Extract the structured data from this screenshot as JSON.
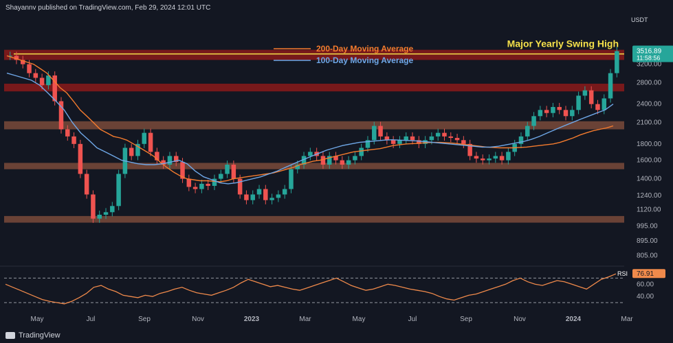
{
  "header": {
    "publisher": "Shayannv published on TradingView.com, Feb 29, 2024 12:01 UTC"
  },
  "footer": {
    "brand": "TradingView"
  },
  "colors": {
    "bg": "#131722",
    "up": "#26a69a",
    "down": "#ef5350",
    "ma200": "#f57c2e",
    "ma100": "#6fa8e8",
    "zone_red": "#8b1a1a",
    "zone_brown": "#7a4a3a",
    "rsi": "#f08a4b",
    "swing": "#f5e04a"
  },
  "chart_data": {
    "type": "candlestick",
    "currency": "USDT",
    "price_scale": "log",
    "ylim": [
      760,
      4050
    ],
    "price_ticks": [
      "3200.00",
      "2800.00",
      "2400.00",
      "2100.00",
      "1800.00",
      "1600.00",
      "1400.00",
      "1240.00",
      "1120.00",
      "995.00",
      "895.00",
      "805.00"
    ],
    "last_price": "3516.89",
    "countdown": "11:58:56",
    "time_labels": [
      "May",
      "Jul",
      "Sep",
      "Nov",
      "2023",
      "Mar",
      "May",
      "Jul",
      "Sep",
      "Nov",
      "2024",
      "Mar"
    ],
    "annotation": "Major Yearly Swing High",
    "legend": [
      "200-Day Moving Average",
      "100-Day Moving Average"
    ],
    "zones": [
      {
        "color": "red",
        "low": 3300,
        "high": 3550
      },
      {
        "color": "red",
        "low": 2630,
        "high": 2780
      },
      {
        "color": "brown",
        "low": 2000,
        "high": 2120
      },
      {
        "color": "brown",
        "low": 1500,
        "high": 1570
      },
      {
        "color": "brown",
        "low": 1020,
        "high": 1070
      }
    ],
    "closes": [
      3400,
      3300,
      3200,
      3000,
      2900,
      2750,
      2950,
      2450,
      2000,
      1900,
      1800,
      1450,
      1250,
      1050,
      1080,
      1100,
      1150,
      1450,
      1750,
      1650,
      1800,
      1950,
      1700,
      1600,
      1550,
      1650,
      1580,
      1400,
      1320,
      1300,
      1350,
      1330,
      1400,
      1450,
      1550,
      1400,
      1250,
      1200,
      1250,
      1300,
      1200,
      1220,
      1250,
      1300,
      1500,
      1550,
      1650,
      1700,
      1650,
      1550,
      1650,
      1600,
      1550,
      1600,
      1650,
      1750,
      1850,
      2050,
      1900,
      1850,
      1800,
      1850,
      1900,
      1850,
      1800,
      1850,
      1900,
      1950,
      1900,
      1880,
      1850,
      1800,
      1650,
      1620,
      1600,
      1620,
      1650,
      1600,
      1700,
      1800,
      1900,
      2050,
      2200,
      2300,
      2250,
      2350,
      2300,
      2200,
      2300,
      2550,
      2650,
      2400,
      2300,
      2500,
      3000,
      3516.89
    ],
    "ma200": [
      3400,
      3350,
      3300,
      3250,
      3200,
      3100,
      3000,
      2850,
      2700,
      2600,
      2450,
      2300,
      2200,
      2100,
      2000,
      1950,
      1900,
      1880,
      1850,
      1800,
      1750,
      1700,
      1650,
      1580,
      1520,
      1470,
      1430,
      1400,
      1390,
      1380,
      1380,
      1375,
      1370,
      1380,
      1400,
      1410,
      1420,
      1430,
      1440,
      1450,
      1460,
      1480,
      1500,
      1520,
      1550,
      1570,
      1590,
      1600,
      1620,
      1640,
      1660,
      1680,
      1700,
      1710,
      1720,
      1730,
      1740,
      1760,
      1780,
      1790,
      1800,
      1805,
      1810,
      1815,
      1820,
      1820,
      1815,
      1810,
      1800,
      1790,
      1780,
      1770,
      1760,
      1755,
      1750,
      1750,
      1750,
      1755,
      1760,
      1770,
      1780,
      1790,
      1800,
      1820,
      1850,
      1880,
      1920,
      1950,
      1980,
      2000,
      2020,
      2050
    ],
    "ma100": [
      3000,
      2950,
      2900,
      2850,
      2750,
      2600,
      2450,
      2300,
      2100,
      1950,
      1850,
      1750,
      1700,
      1650,
      1600,
      1580,
      1560,
      1550,
      1550,
      1560,
      1580,
      1600,
      1560,
      1480,
      1420,
      1390,
      1360,
      1350,
      1360,
      1380,
      1400,
      1420,
      1450,
      1480,
      1520,
      1560,
      1600,
      1640,
      1680,
      1720,
      1750,
      1780,
      1800,
      1820,
      1830,
      1840,
      1850,
      1855,
      1850,
      1845,
      1840,
      1830,
      1820,
      1810,
      1800,
      1790,
      1780,
      1770,
      1760,
      1760,
      1770,
      1790,
      1810,
      1830,
      1860,
      1900,
      1950,
      2000,
      2050,
      2100,
      2150,
      2200,
      2250,
      2300,
      2400
    ],
    "rsi_label": "RSI",
    "rsi_last": "76.91",
    "rsi_ticks": [
      "60.00",
      "40.00"
    ],
    "rsi_levels": [
      70,
      30
    ],
    "rsi": [
      60,
      55,
      50,
      45,
      40,
      35,
      32,
      30,
      28,
      32,
      38,
      45,
      55,
      58,
      52,
      48,
      42,
      40,
      38,
      42,
      40,
      45,
      48,
      52,
      55,
      50,
      46,
      44,
      42,
      46,
      50,
      55,
      62,
      68,
      64,
      60,
      56,
      58,
      55,
      52,
      50,
      54,
      58,
      62,
      66,
      70,
      64,
      58,
      54,
      50,
      52,
      56,
      60,
      58,
      55,
      52,
      50,
      48,
      45,
      40,
      36,
      34,
      38,
      42,
      44,
      48,
      52,
      56,
      60,
      66,
      70,
      64,
      60,
      58,
      62,
      66,
      64,
      60,
      56,
      52,
      60,
      68,
      72,
      76.91
    ]
  }
}
